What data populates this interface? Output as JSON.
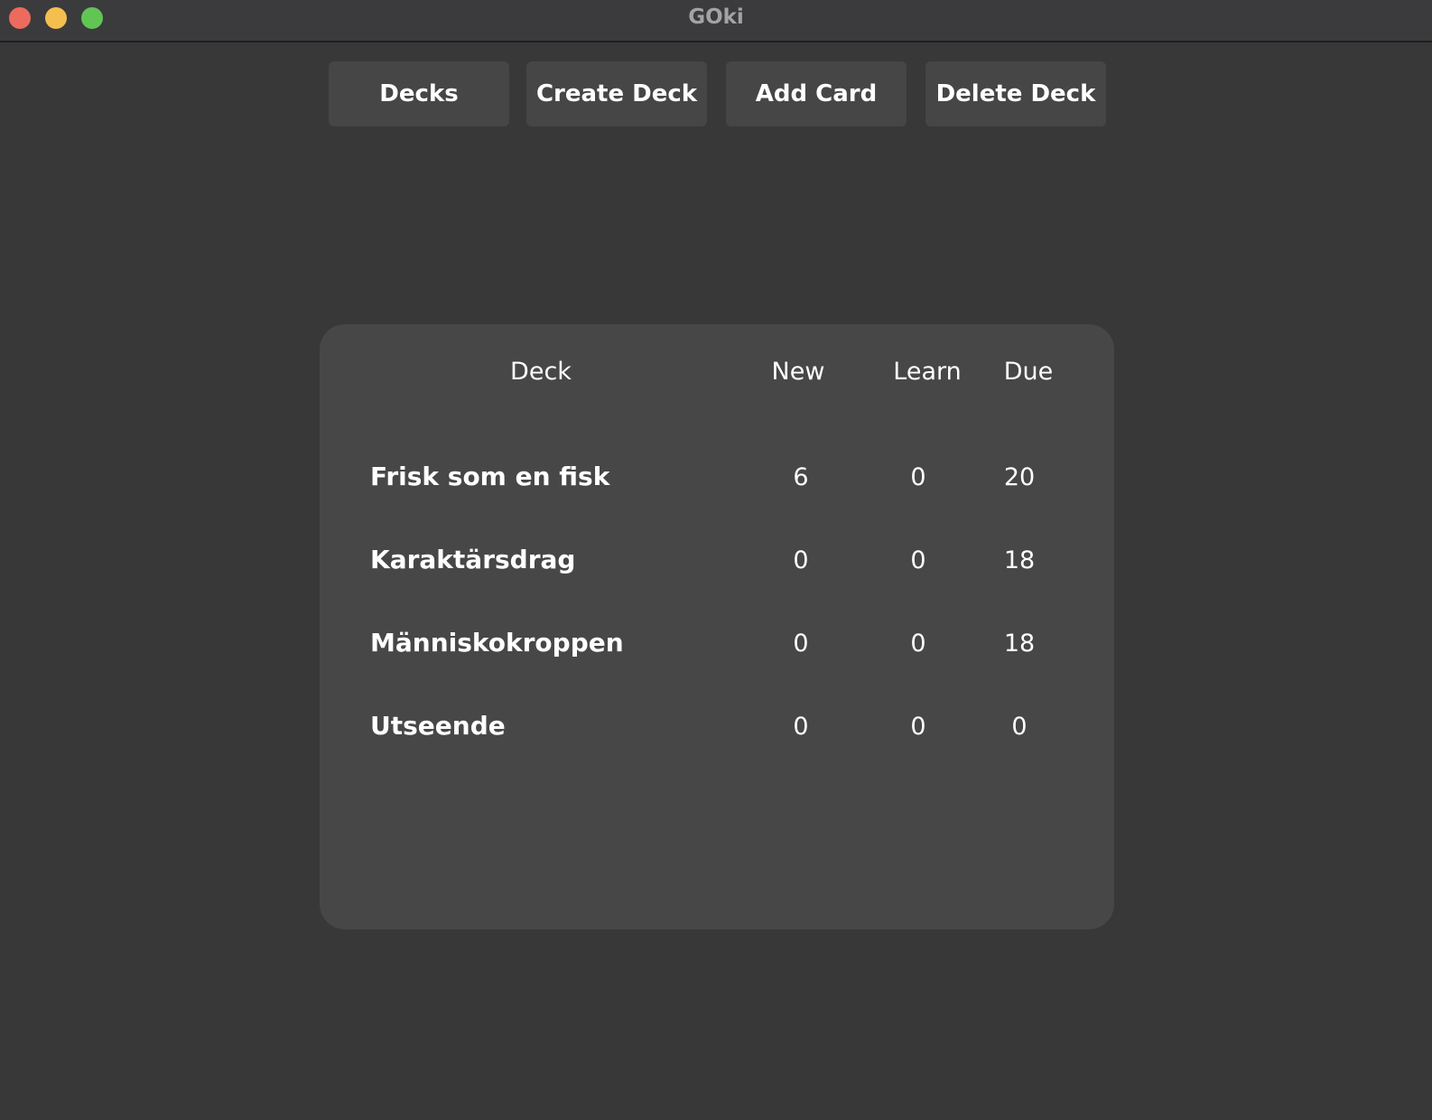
{
  "window": {
    "title": "GOki",
    "colors": {
      "close": "#ed6a5e",
      "minimize": "#f5bf4f",
      "maximize": "#61c554"
    }
  },
  "toolbar": {
    "decks_label": "Decks",
    "create_deck_label": "Create Deck",
    "add_card_label": "Add Card",
    "delete_deck_label": "Delete Deck"
  },
  "table": {
    "headers": {
      "deck": "Deck",
      "new": "New",
      "learn": "Learn",
      "due": "Due"
    },
    "rows": [
      {
        "name": "Frisk som en fisk",
        "new": "6",
        "learn": "0",
        "due": "20"
      },
      {
        "name": "Karaktärsdrag",
        "new": "0",
        "learn": "0",
        "due": "18"
      },
      {
        "name": "Människokroppen",
        "new": "0",
        "learn": "0",
        "due": "18"
      },
      {
        "name": "Utseende",
        "new": "0",
        "learn": "0",
        "due": "0"
      }
    ]
  }
}
